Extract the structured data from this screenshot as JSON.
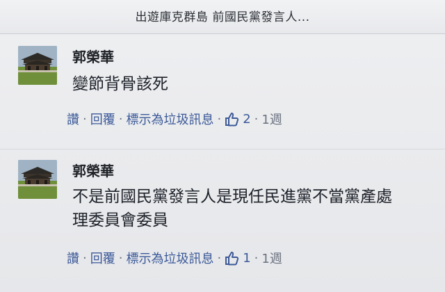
{
  "header": {
    "title": "出遊庫克群島 前國民黨發言人..."
  },
  "comments": [
    {
      "author": "郭榮華",
      "text": "變節背骨該死",
      "actions": {
        "like": "讚",
        "reply": "回覆",
        "spam": "標示為垃圾訊息",
        "like_count": "2",
        "time": "1週"
      }
    },
    {
      "author": "郭榮華",
      "text_lines": [
        "不是前國民黨發言人是現任民進黨不當黨產處",
        "理委員會委員"
      ],
      "actions": {
        "like": "讚",
        "reply": "回覆",
        "spam": "標示為垃圾訊息",
        "like_count": "1",
        "time": "1週"
      }
    }
  ],
  "separator": "·",
  "icons": {
    "like": "thumbs-up-icon",
    "avatar": "temple-photo-avatar"
  },
  "colors": {
    "link": "#3b5998",
    "muted": "#6b7280",
    "text": "#1d2129"
  }
}
